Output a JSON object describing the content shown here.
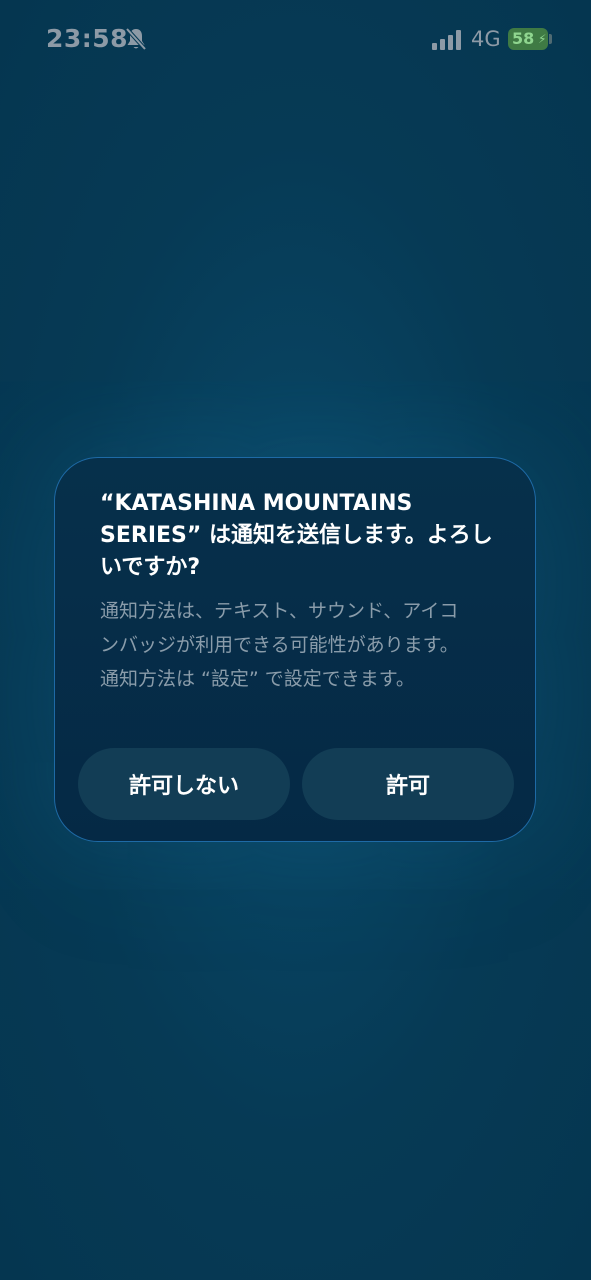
{
  "status_bar": {
    "time": "23:58",
    "network": "4G",
    "battery": "58",
    "icons": [
      "bell-slash-icon",
      "signal-icon",
      "battery-icon",
      "charging-bolt-icon"
    ]
  },
  "dialog": {
    "title": "“KATASHINA MOUNTAINS SERIES” は通知を送信します。よろしいですか?",
    "message": "通知方法は、テキスト、サウンド、アイコンバッジが利用できる可能性があります。通知方法は “設定” で設定できます。",
    "deny_label": "許可しない",
    "allow_label": "許可"
  },
  "colors": {
    "background": "#063a55",
    "dialog_background": "#052945",
    "dialog_border": "#1e6aa6",
    "button_background": "#123d55",
    "message_text": "#8a9caa",
    "battery_fill": "#3f7a44"
  }
}
